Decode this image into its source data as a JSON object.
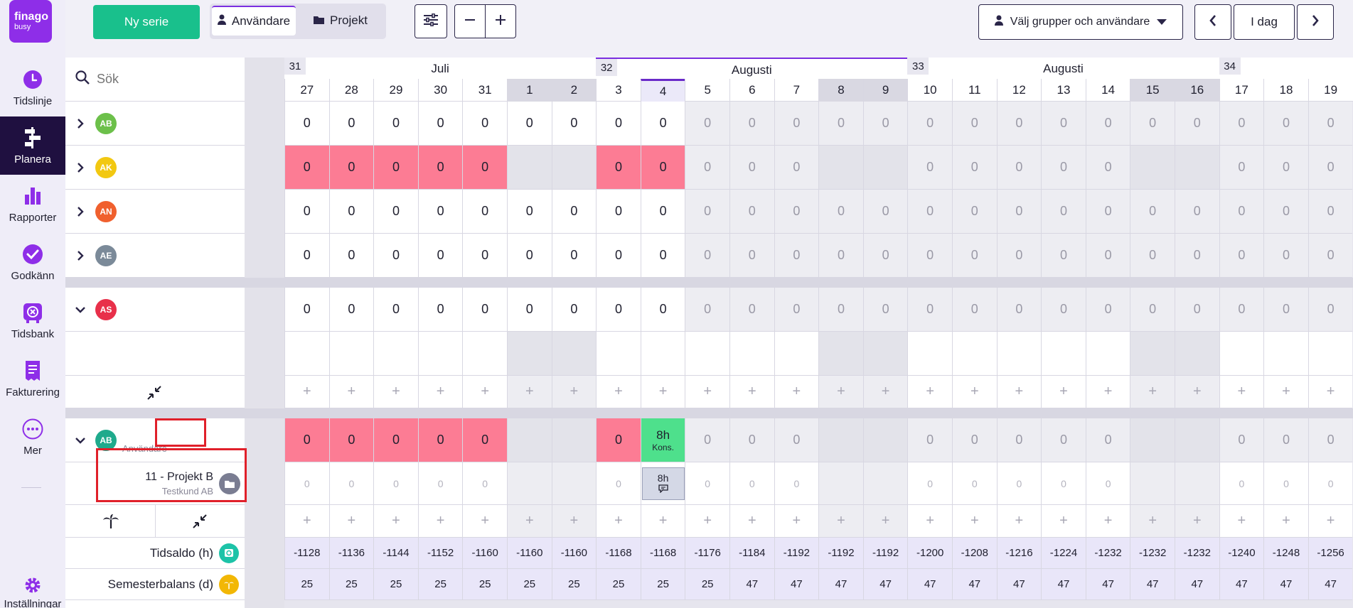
{
  "logo": {
    "line1": "finago",
    "line2": "busy"
  },
  "nav": [
    {
      "label": "Tidslinje",
      "icon": "clock-icon"
    },
    {
      "label": "Planera",
      "icon": "planning-icon",
      "active": true
    },
    {
      "label": "Rapporter",
      "icon": "bar-chart-icon"
    },
    {
      "label": "Godkänn",
      "icon": "check-circle-icon"
    },
    {
      "label": "Tidsbank",
      "icon": "timebank-icon"
    },
    {
      "label": "Fakturering",
      "icon": "invoice-icon"
    },
    {
      "label": "Mer",
      "icon": "more-icon"
    },
    {
      "label": "Inställningar",
      "icon": "gear-icon"
    }
  ],
  "toolbar": {
    "new_series": "Ny serie",
    "tab_users": "Användare",
    "tab_projects": "Projekt",
    "group_select": "Välj grupper och användare",
    "today": "I dag"
  },
  "search": {
    "placeholder": "Sök",
    "value": ""
  },
  "colors": {
    "accent": "#7b2ee0",
    "primary": "#19c08c",
    "absence": "#fc7c94",
    "booked": "#4ee08c"
  },
  "weeks": [
    {
      "num": "31",
      "month": "Juli"
    },
    {
      "num": "32",
      "month": "Augusti"
    },
    {
      "num": "33",
      "month": "Augusti"
    },
    {
      "num": "34",
      "month": ""
    }
  ],
  "days": [
    "27",
    "28",
    "29",
    "30",
    "31",
    "1",
    "2",
    "3",
    "4",
    "5",
    "6",
    "7",
    "8",
    "9",
    "10",
    "11",
    "12",
    "13",
    "14",
    "15",
    "16",
    "17",
    "18",
    "19"
  ],
  "users": [
    {
      "initials": "AB",
      "color": "#6cc04a"
    },
    {
      "initials": "AK",
      "color": "#f2c811"
    },
    {
      "initials": "AN",
      "color": "#f0602e"
    },
    {
      "initials": "AE",
      "color": "#7b8a99"
    },
    {
      "initials": "AS",
      "color": "#e8304a"
    },
    {
      "initials": "AB",
      "color": "#1faa8c",
      "role": "Användare"
    }
  ],
  "project": {
    "name": "11 - Projekt B",
    "client": "Testkund AB"
  },
  "booking": {
    "hours": "8h",
    "label": "Kons.",
    "comment_hours": "8h"
  },
  "stats": {
    "tidsaldo_label": "Tidsaldo (h)",
    "semester_label": "Semesterbalans (d)",
    "tidsaldo": [
      "-1128",
      "-1136",
      "-1144",
      "-1152",
      "-1160",
      "-1160",
      "-1160",
      "-1168",
      "-1168",
      "-1176",
      "-1184",
      "-1192",
      "-1192",
      "-1192",
      "-1200",
      "-1208",
      "-1216",
      "-1224",
      "-1232",
      "-1232",
      "-1232",
      "-1240",
      "-1248",
      "-1256"
    ],
    "semester": [
      "25",
      "25",
      "25",
      "25",
      "25",
      "25",
      "25",
      "25",
      "25",
      "25",
      "47",
      "47",
      "47",
      "47",
      "47",
      "47",
      "47",
      "47",
      "47",
      "47",
      "47",
      "47",
      "47",
      "47"
    ]
  },
  "zero": "0",
  "plus": "+"
}
